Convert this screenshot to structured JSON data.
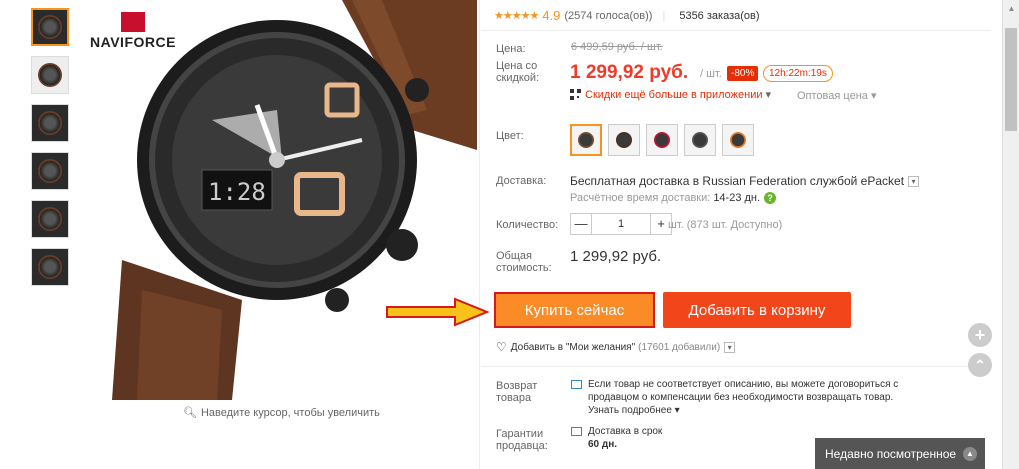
{
  "product": {
    "brand": "NAVIFORCE",
    "zoom_hint": "Наведите курсор, чтобы увеличить"
  },
  "rating": {
    "stars": "★★★★★",
    "value": "4.9",
    "votes": "(2574 голоса(ов))",
    "orders": "5356 заказа(ов)"
  },
  "price": {
    "label_price": "Цена:",
    "old": "6 499,59 руб. / шт.",
    "label_discount_price": "Цена со скидкой:",
    "new": "1 299,92 руб.",
    "per_unit": "/ шт.",
    "discount": "-80%",
    "timer": "12h:22m:19s",
    "app_promo": "Скидки ещё больше в приложении",
    "app_promo_arrow": "▾",
    "wholesale": "Оптовая цена ▾"
  },
  "color": {
    "label": "Цвет:",
    "options": [
      {
        "color": "#2a2a2a",
        "band": "#7a4a2a"
      },
      {
        "color": "#2a2a2a",
        "band": "#4a2f22"
      },
      {
        "color": "#2a2a2a",
        "band": "#c8102e"
      },
      {
        "color": "#2a2a2a",
        "band": "#555555"
      },
      {
        "color": "#2a2a2a",
        "band": "#e07a24"
      }
    ]
  },
  "shipping": {
    "label": "Доставка:",
    "text": "Бесплатная доставка в Russian Federation службой ePacket",
    "dropdown_glyph": "▾",
    "time_label": "Расчётное время доставки:",
    "time_days": "14-23 дн.",
    "help_glyph": "?"
  },
  "quantity": {
    "label": "Количество:",
    "minus": "—",
    "value": "1",
    "plus": "+",
    "available": "шт. (873 шт. Доступно)"
  },
  "total": {
    "label_line1": "Общая",
    "label_line2": "стоимость:",
    "value": "1 299,92 руб."
  },
  "actions": {
    "buy_now": "Купить сейчас",
    "add_to_cart": "Добавить в корзину",
    "wishlist": "Добавить в \"Мои желания\"",
    "wishlist_count": "(17601 добавили)",
    "wishlist_dropdown": "▾"
  },
  "return": {
    "label_line1": "Возврат",
    "label_line2": "товара",
    "text": "Если товар не соответствует описанию, вы можете договориться с продавцом о компенсации без необходимости возвращать товар.",
    "more": "Узнать подробнее ▾"
  },
  "guarantee": {
    "label_line1": "Гарантии",
    "label_line2": "продавца:",
    "text_line1": "Доставка в срок",
    "text_line2": "60 дн."
  },
  "side": {
    "plus": "+",
    "up": "⌃"
  },
  "recent": {
    "label": "Недавно посмотренное",
    "chevron": "▲"
  },
  "scrollbar": {
    "up": "▲"
  },
  "colors": {
    "accent_orange": "#f7931e",
    "price_red": "#f13a2b",
    "buy_now": "#fa8b26",
    "add_to_cart": "#f2461a"
  }
}
